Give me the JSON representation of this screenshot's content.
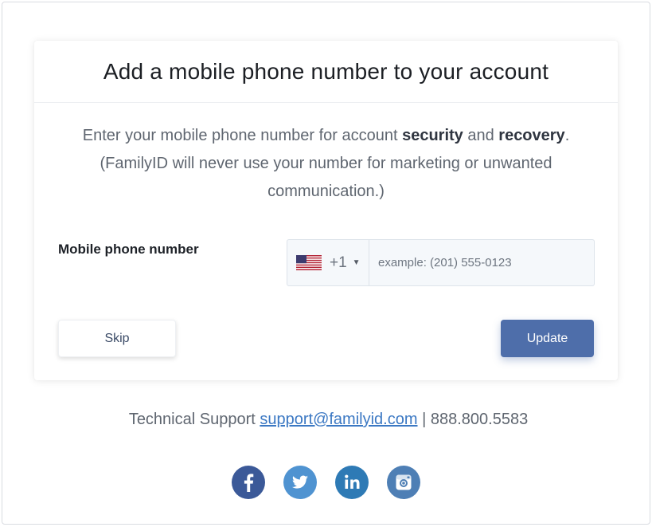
{
  "card": {
    "title": "Add a mobile phone number to your account",
    "description_prefix": "Enter your mobile phone number for account ",
    "description_bold1": "security",
    "description_mid": " and ",
    "description_bold2": "recovery",
    "description_suffix": ". (FamilyID will never use your number for marketing or unwanted communication.)"
  },
  "phone": {
    "label": "Mobile phone number",
    "country_icon": "us-flag-icon",
    "dial_code": "+1",
    "placeholder": "example: (201) 555-0123",
    "value": ""
  },
  "buttons": {
    "skip_label": "Skip",
    "update_label": "Update"
  },
  "footer": {
    "support_label": "Technical Support",
    "support_email": "support@familyid.com",
    "separator": "|",
    "support_phone": "888.800.5583"
  },
  "social": [
    {
      "icon": "facebook-icon",
      "color": "#3b5998"
    },
    {
      "icon": "twitter-icon",
      "color": "#4f93d1"
    },
    {
      "icon": "linkedin-icon",
      "color": "#2e7ab5"
    },
    {
      "icon": "instagram-icon",
      "color": "#4e7fb5"
    }
  ],
  "colors": {
    "accent": "#4e6eaa",
    "link": "#3b78c3",
    "text_muted": "#5f6670"
  }
}
